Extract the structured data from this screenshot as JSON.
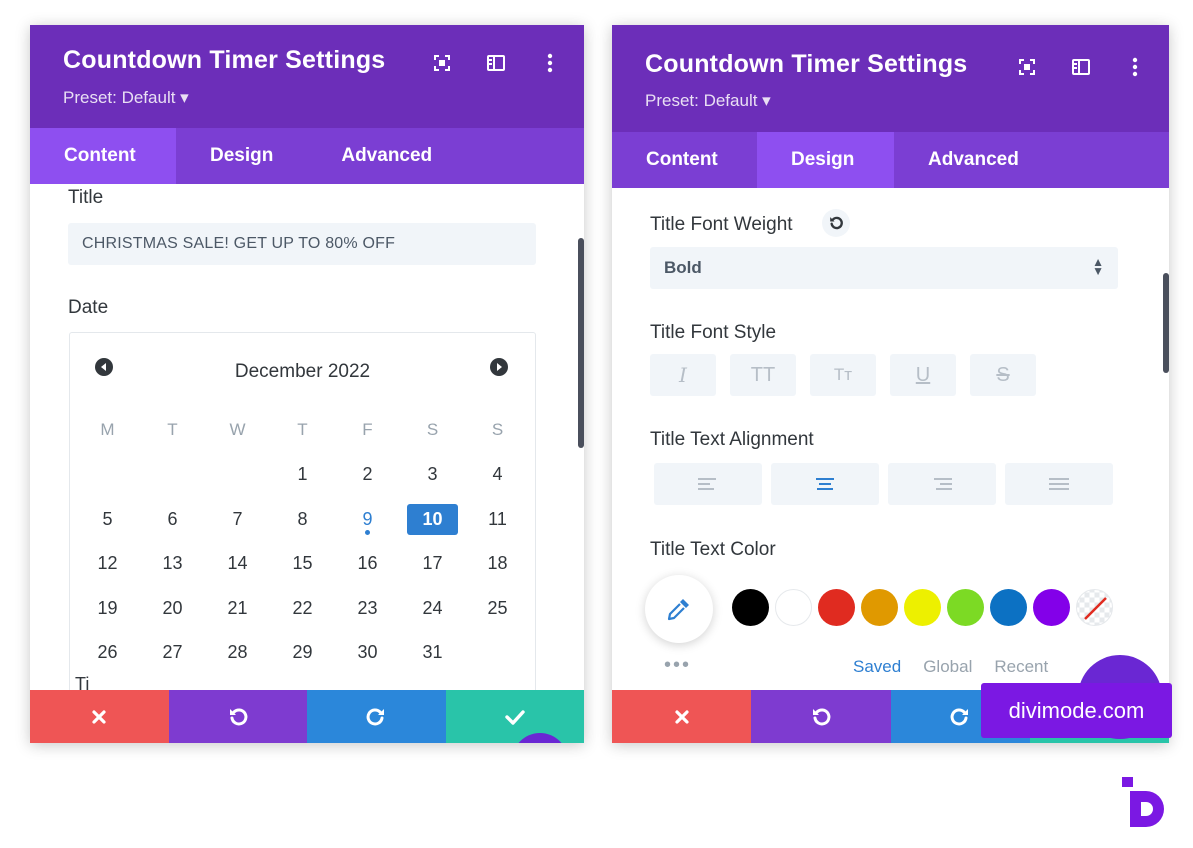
{
  "left_panel": {
    "title": "Countdown Timer Settings",
    "preset": "Preset: Default ▾",
    "tabs": [
      {
        "label": "Content",
        "active": true
      },
      {
        "label": "Design",
        "active": false
      },
      {
        "label": "Advanced",
        "active": false
      }
    ],
    "title_label": "Title",
    "title_value": "CHRISTMAS SALE! GET UP TO 80% OFF",
    "date_label": "Date",
    "calendar": {
      "month_label": "December 2022",
      "weekdays": [
        "M",
        "T",
        "W",
        "T",
        "F",
        "S",
        "S"
      ],
      "leading_blanks": 3,
      "days": [
        "1",
        "2",
        "3",
        "4",
        "5",
        "6",
        "7",
        "8",
        "9",
        "10",
        "11",
        "12",
        "13",
        "14",
        "15",
        "16",
        "17",
        "18",
        "19",
        "20",
        "21",
        "22",
        "23",
        "24",
        "25",
        "26",
        "27",
        "28",
        "29",
        "30",
        "31"
      ],
      "today": "9",
      "selected": "10"
    },
    "next_label_partial": "Ti"
  },
  "right_panel": {
    "title": "Countdown Timer Settings",
    "preset": "Preset: Default ▾",
    "tabs": [
      {
        "label": "Content",
        "active": false
      },
      {
        "label": "Design",
        "active": true
      },
      {
        "label": "Advanced",
        "active": false
      }
    ],
    "font_weight_label": "Title Font Weight",
    "font_weight_value": "Bold",
    "font_style_label": "Title Font Style",
    "font_style_buttons": [
      {
        "name": "italic",
        "glyph": "I"
      },
      {
        "name": "uppercase",
        "glyph": "TT"
      },
      {
        "name": "smallcaps",
        "glyph": "Tт"
      },
      {
        "name": "underline",
        "glyph": "U"
      },
      {
        "name": "strikethrough",
        "glyph": "S"
      }
    ],
    "alignment_label": "Title Text Alignment",
    "alignment_active": "center",
    "color_label": "Title Text Color",
    "swatches": [
      "#000000",
      "#ffffff",
      "#e02b20",
      "#e09900",
      "#edf000",
      "#7cda24",
      "#0c71c3",
      "#8300e9",
      "transparent"
    ],
    "color_tabs": [
      {
        "label": "Saved",
        "active": true
      },
      {
        "label": "Global",
        "active": false
      },
      {
        "label": "Recent",
        "active": false
      }
    ],
    "dots": "•••"
  },
  "watermark": "divimode.com",
  "colors": {
    "header": "#6c2eb9",
    "tabs": "#7b3ed3",
    "tab_active": "#8e4ff0",
    "cancel": "#ef5555",
    "undo": "#7e3bd0",
    "redo": "#2b87da",
    "save": "#29c4a9",
    "accent": "#2e7fd1"
  }
}
